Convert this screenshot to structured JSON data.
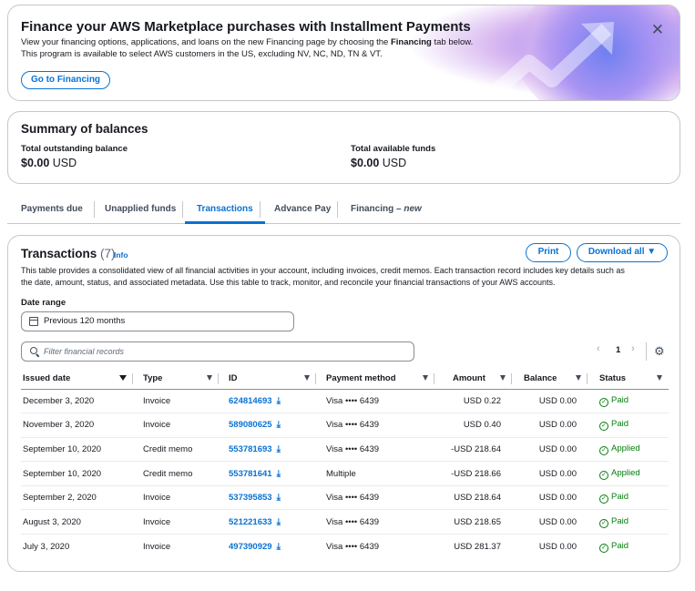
{
  "banner": {
    "title": "Finance your AWS Marketplace purchases with Installment Payments",
    "line1_pre": "View your financing options, applications, and loans on the new Financing page by choosing the ",
    "line1_bold": "Financing",
    "line1_post": " tab below.",
    "line2": "This program is available to select AWS customers in the US, excluding NV, NC, ND, TN & VT.",
    "button": "Go to Financing",
    "close": "✕"
  },
  "summary": {
    "title": "Summary of balances",
    "outstanding_label": "Total outstanding balance",
    "outstanding_amount": "$0.00",
    "outstanding_currency": "USD",
    "available_label": "Total available funds",
    "available_amount": "$0.00",
    "available_currency": "USD"
  },
  "tabs": [
    {
      "label": "Payments due"
    },
    {
      "label": "Unapplied funds"
    },
    {
      "label": "Transactions"
    },
    {
      "label": "Advance Pay"
    },
    {
      "label": "Financing – ",
      "suffix": "new"
    }
  ],
  "transactions": {
    "title": "Transactions",
    "count": "(7)",
    "info": "Info",
    "print": "Print",
    "download": "Download all",
    "desc1": "This table provides a consolidated view of all financial activities in your account, including invoices, credit memos. Each transaction record includes key details such as",
    "desc2": "the date, amount, status, and associated metadata. Use this table to track, monitor, and reconcile your financial transactions of your AWS accounts.",
    "date_label": "Date range",
    "date_value": "Previous 120 months",
    "search_placeholder": "Filter financial records",
    "page": "1",
    "columns": [
      "Issued date",
      "Type",
      "ID",
      "Payment method",
      "Amount",
      "Balance",
      "Status"
    ],
    "rows": [
      {
        "date": "December 3, 2020",
        "type": "Invoice",
        "id": "624814693",
        "method": "Visa •••• 6439",
        "amount": "USD 0.22",
        "balance": "USD 0.00",
        "status": "Paid"
      },
      {
        "date": "November 3, 2020",
        "type": "Invoice",
        "id": "589080625",
        "method": "Visa •••• 6439",
        "amount": "USD 0.40",
        "balance": "USD 0.00",
        "status": "Paid"
      },
      {
        "date": "September 10, 2020",
        "type": "Credit memo",
        "id": "553781693",
        "method": "Visa •••• 6439",
        "amount": "-USD 218.64",
        "balance": "USD 0.00",
        "status": "Applied"
      },
      {
        "date": "September 10, 2020",
        "type": "Credit memo",
        "id": "553781641",
        "method": "Multiple",
        "amount": "-USD 218.66",
        "balance": "USD 0.00",
        "status": "Applied"
      },
      {
        "date": "September 2, 2020",
        "type": "Invoice",
        "id": "537395853",
        "method": "Visa •••• 6439",
        "amount": "USD 218.64",
        "balance": "USD 0.00",
        "status": "Paid"
      },
      {
        "date": "August 3, 2020",
        "type": "Invoice",
        "id": "521221633",
        "method": "Visa •••• 6439",
        "amount": "USD 218.65",
        "balance": "USD 0.00",
        "status": "Paid"
      },
      {
        "date": "July 3, 2020",
        "type": "Invoice",
        "id": "497390929",
        "method": "Visa •••• 6439",
        "amount": "USD 281.37",
        "balance": "USD 0.00",
        "status": "Paid"
      }
    ]
  },
  "colors": {
    "accent": "#0972d3",
    "success": "#037f0c",
    "border": "#c6c6cd"
  },
  "icons": [
    "close-icon",
    "calendar-icon",
    "search-icon",
    "chevron-left-icon",
    "chevron-right-icon",
    "gear-icon",
    "download-icon",
    "check-circle-icon",
    "caret-down-icon",
    "growth-arrow-icon"
  ]
}
